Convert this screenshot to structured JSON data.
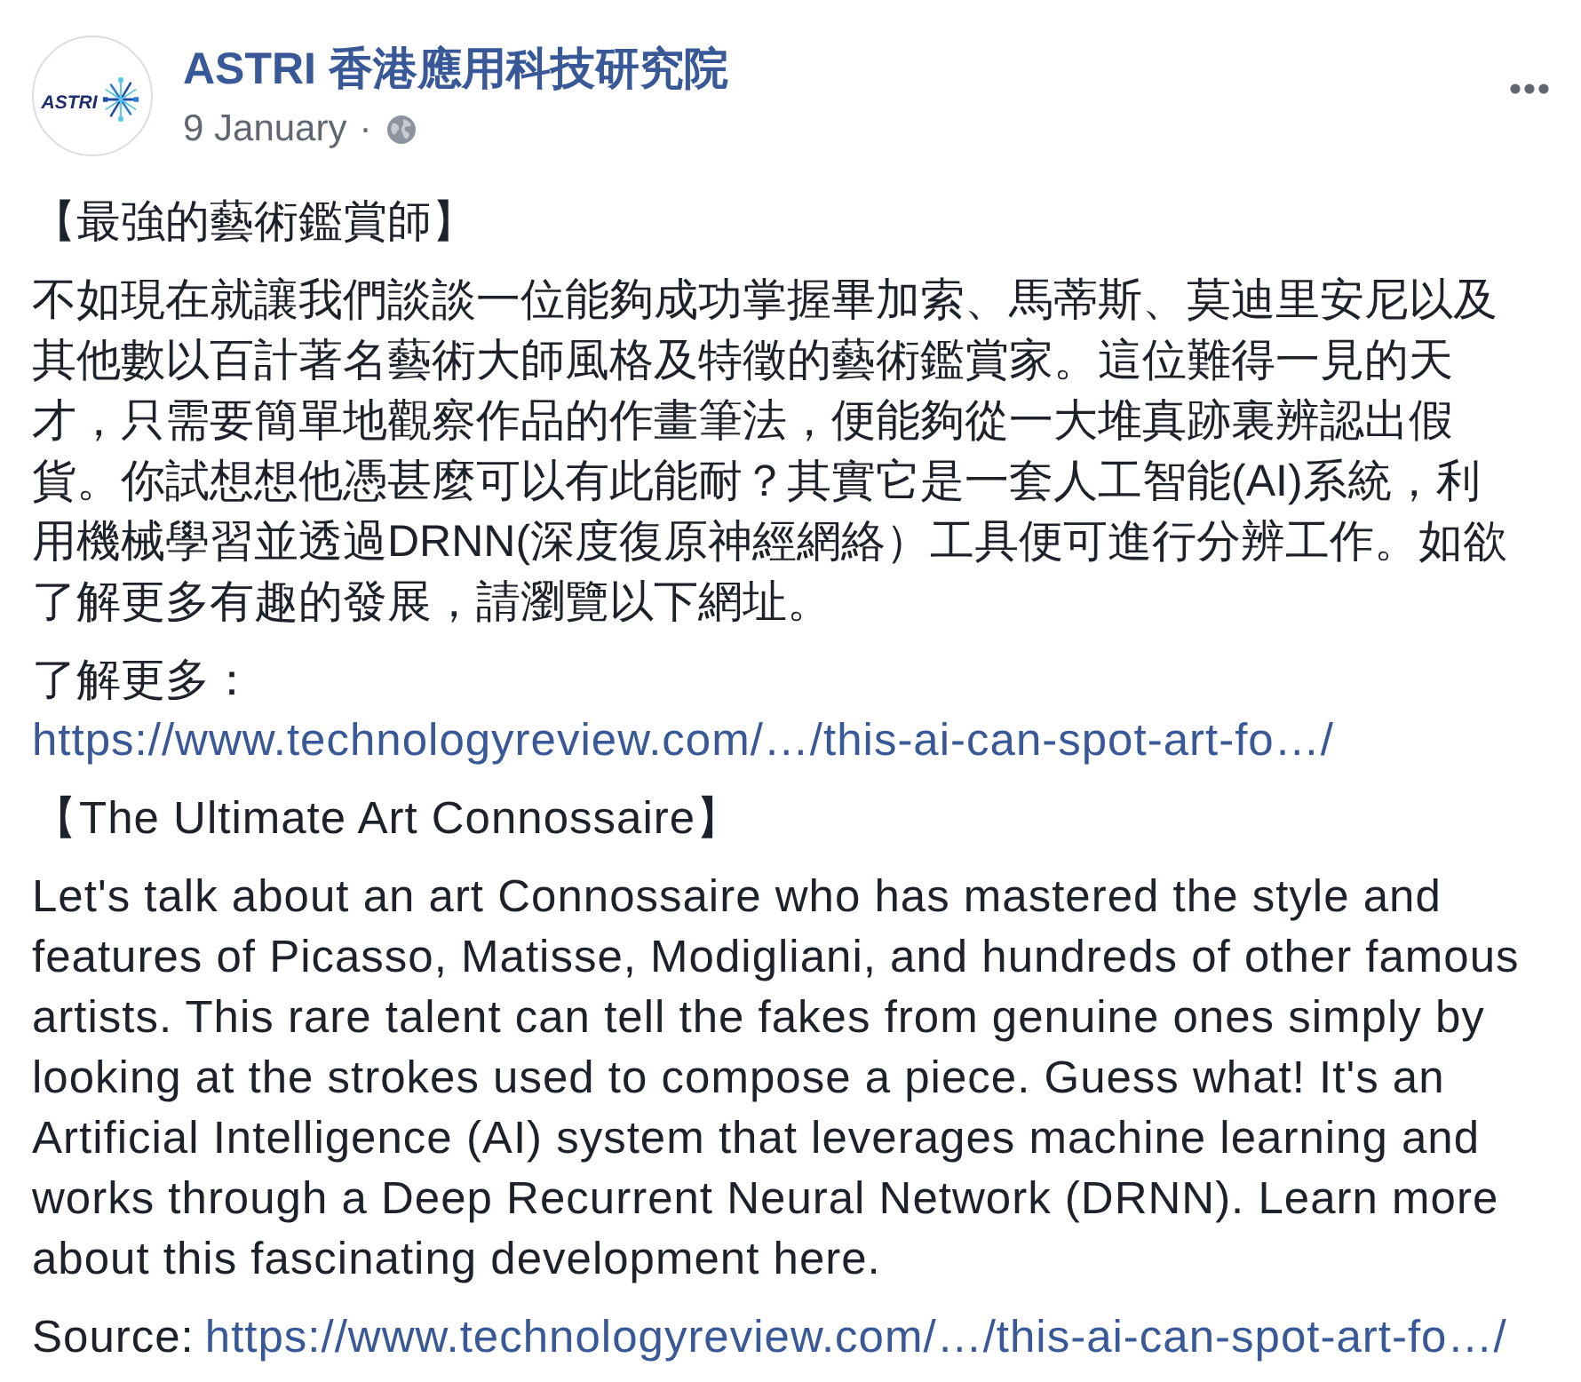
{
  "post": {
    "author": {
      "name": "ASTRI 香港應用科技研究院",
      "logo_text": "ASTRI"
    },
    "date": "9 January",
    "separator": "·",
    "body": [
      {
        "kind": "heading",
        "text": "【最強的藝術鑑賞師】"
      },
      {
        "kind": "paragraph",
        "text": "不如現在就讓我們談談一位能夠成功掌握畢加索、馬蒂斯、莫迪里安尼以及其他數以百計著名藝術大師風格及特徵的藝術鑑賞家。這位難得一見的天才，只需要簡單地觀察作品的作畫筆法，便能夠從一大堆真跡裏辨認出假貨。你試想想他憑甚麼可以有此能耐？其實它是一套人工智能(AI)系統，利用機械學習並透過DRNN(深度復原神經網絡）工具便可進行分辨工作。如欲了解更多有趣的發展，請瀏覽以下網址。"
      },
      {
        "kind": "link",
        "label": "了解更多：",
        "link_text": "https://www.technologyreview.com/…/this-ai-can-spot-art-fo…/"
      },
      {
        "kind": "heading",
        "text": "【The Ultimate Art Connossaire】"
      },
      {
        "kind": "paragraph",
        "text": "Let's talk about an art Connossaire who has mastered the style and features of Picasso, Matisse, Modigliani, and hundreds of other famous artists. This rare talent can tell the fakes from genuine ones simply by looking at the strokes used to compose a piece. Guess what! It's an Artificial Intelligence (AI) system that leverages machine learning and works through a Deep Recurrent Neural Network (DRNN). Learn more about this fascinating development here."
      },
      {
        "kind": "link",
        "label": "Source:",
        "link_text": "https://www.technologyreview.com/…/this-ai-can-spot-art-fo…/"
      }
    ]
  }
}
